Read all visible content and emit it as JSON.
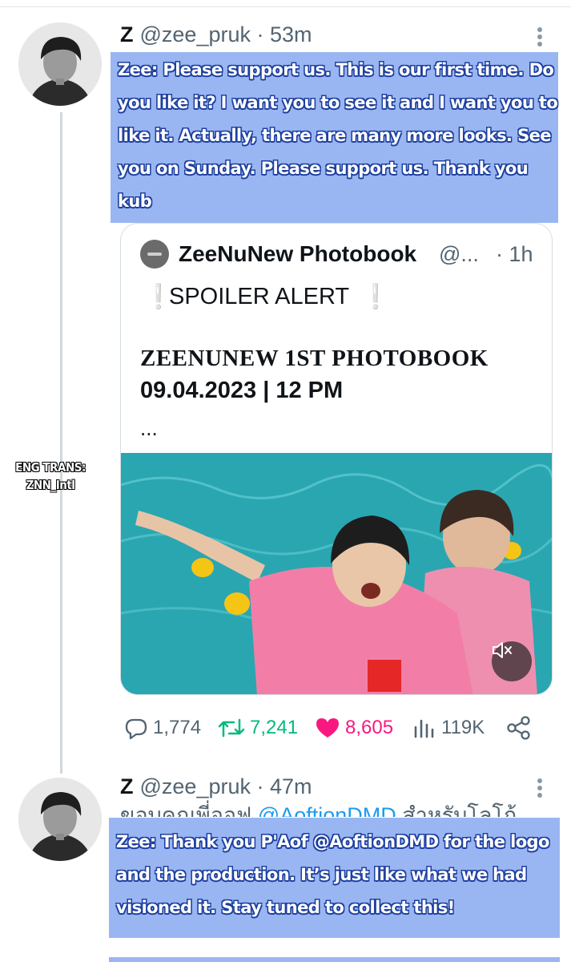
{
  "tweets": [
    {
      "name": "Z",
      "handle": "@zee_pruk",
      "separator": "·",
      "time": "53m",
      "translation": "Zee: Please support us. This is our first time. Do you like it? I want you to see it and I want you to like it. Actually, there are many more looks. See you on Sunday. Please support us. Thank you kub"
    },
    {
      "name": "Z",
      "handle": "@zee_pruk",
      "separator": "·",
      "time": "47m",
      "partial_text_start": "ขอบคุณพี่ออฟ",
      "partial_mention": "@AoftionDMD",
      "partial_text_end": "สำหรับโลโก้",
      "translation": "Zee: Thank you P'Aof @AoftionDMD for the logo and the production. It’s just like what we had visioned it. Stay tuned to collect this!"
    }
  ],
  "quote": {
    "name": "ZeeNuNew Photobook",
    "handle": "@...",
    "time": "· 1h",
    "spoiler_mark": "❕",
    "spoiler_text": "SPOILER ALERT",
    "title": "ZEENUNEW 1ST PHOTOBOOK",
    "date": "09.04.2023 | 12 PM",
    "ellipsis": "..."
  },
  "actions": {
    "replies": "1,774",
    "retweets": "7,241",
    "likes": "8,605",
    "views": "119K"
  },
  "credit": {
    "line1": "ENG TRANS:",
    "line2": "ZNN_Intl"
  },
  "colors": {
    "translation_box": "#9ab6f2",
    "translation_outline": "#1d3fa0",
    "retweet": "#00ba7c",
    "like": "#f91880",
    "muted_text": "#536471",
    "pool_water": "#2aa6b1"
  },
  "icons": [
    "more-icon",
    "reply-icon",
    "retweet-icon",
    "heart-icon",
    "views-icon",
    "share-icon",
    "mute-icon"
  ]
}
